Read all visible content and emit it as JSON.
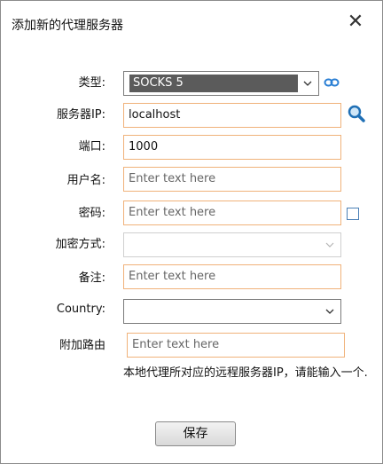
{
  "dialog": {
    "title": "添加新的代理服务器",
    "close_icon": "close-icon",
    "accent": "#f0b27a"
  },
  "form": {
    "type_label": "类型:",
    "type_value": "SOCKS 5",
    "server_ip_label": "服务器IP:",
    "server_ip_value": "localhost",
    "port_label": "端口:",
    "port_value": "1000",
    "username_label": "用户名:",
    "username_placeholder": "Enter text here",
    "password_label": "密码:",
    "password_placeholder": "Enter text here",
    "encryption_label": "加密方式:",
    "remark_label": "备注:",
    "remark_placeholder": "Enter text here",
    "country_label": "Country:",
    "extra_route_label": "附加路由",
    "extra_route_placeholder": "Enter text here",
    "note": "本地代理所对应的远程服务器IP，请能输入一个."
  },
  "footer": {
    "save_label": "保存"
  }
}
